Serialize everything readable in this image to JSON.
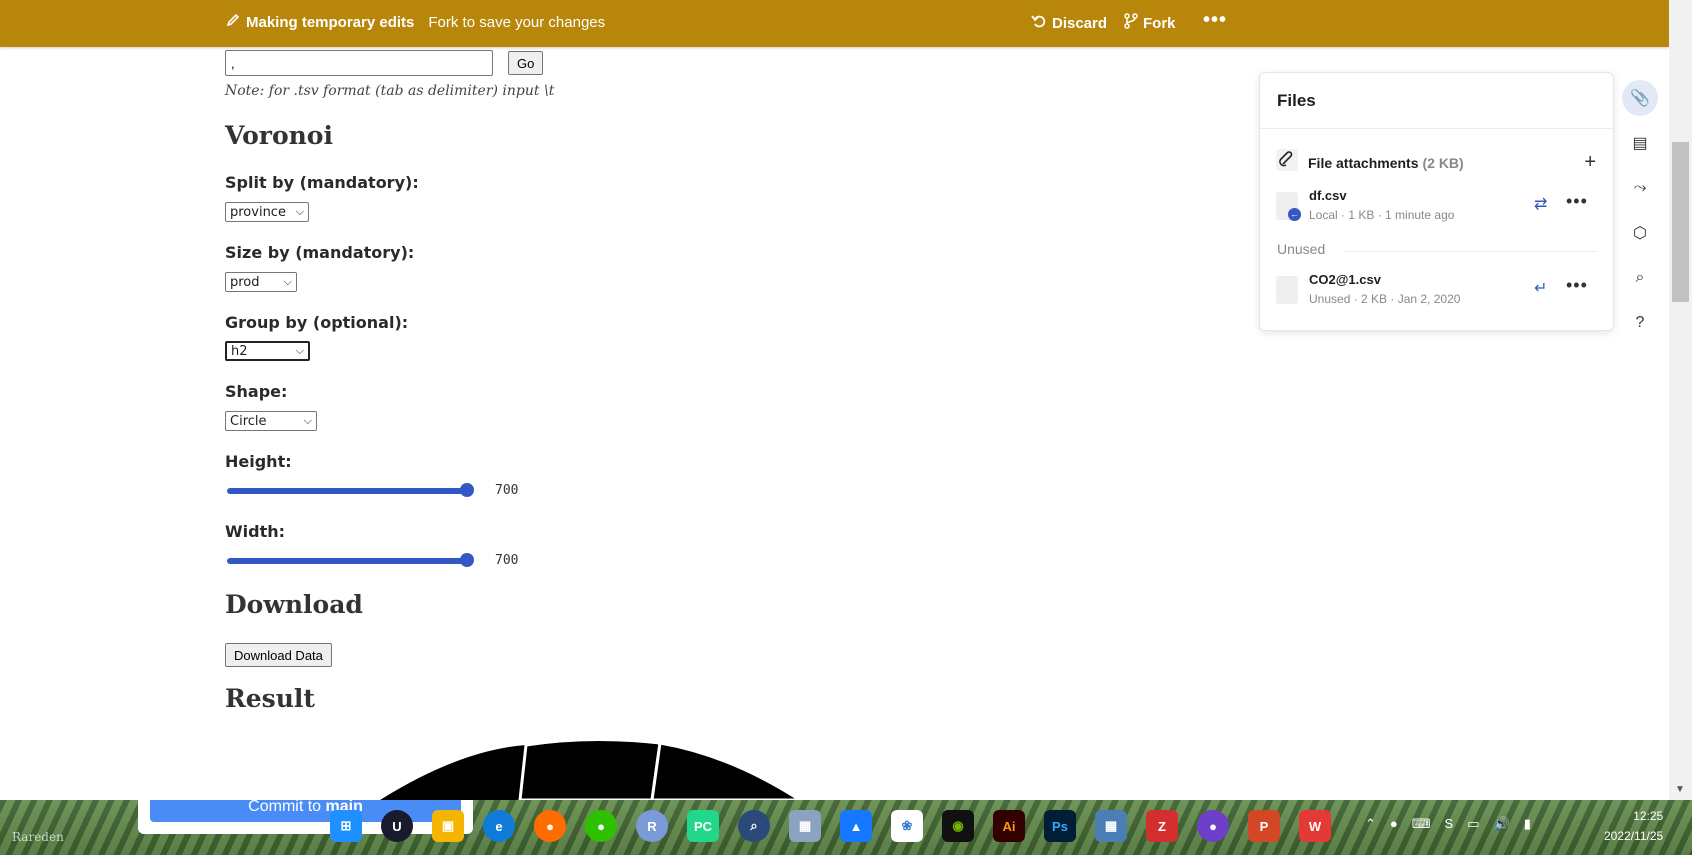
{
  "banner": {
    "title": "Making temporary edits",
    "subtitle": "Fork to save your changes",
    "discard_label": "Discard",
    "fork_label": "Fork",
    "more_label": "•••"
  },
  "form": {
    "delimiter_value": ",",
    "go_label": "Go",
    "note": "Note: for .tsv format (tab as delimiter) input \\t",
    "voronoi_heading": "Voronoi",
    "split_label": "Split by (mandatory):",
    "split_value": "province",
    "size_label": "Size by (mandatory):",
    "size_value": "prod",
    "group_label": "Group by (optional):",
    "group_value": "h2",
    "shape_label": "Shape:",
    "shape_value": "Circle",
    "height_label": "Height:",
    "height_value": 700,
    "height_fraction": 1.0,
    "width_label": "Width:",
    "width_value": 700,
    "width_fraction": 1.0,
    "download_heading": "Download",
    "download_button": "Download Data",
    "result_heading": "Result"
  },
  "files_panel": {
    "title": "Files",
    "attachments_label": "File attachments",
    "attachments_size": "(2 KB)",
    "files": [
      {
        "name": "df.csv",
        "meta": "Local · 1 KB · 1 minute ago"
      }
    ],
    "unused_label": "Unused",
    "unused_files": [
      {
        "name": "CO2@1.csv",
        "meta": "Unused · 2 KB · Jan 2, 2020"
      }
    ]
  },
  "commit": {
    "label_prefix": "Commit to ",
    "label_branch": "main"
  },
  "taskbar": {
    "watermark": "Rareden",
    "clock_time": "12:25",
    "clock_date": "2022/11/25"
  },
  "colors": {
    "banner": "#b8860b",
    "accent": "#3358c4",
    "commit": "#4a8cf5"
  }
}
